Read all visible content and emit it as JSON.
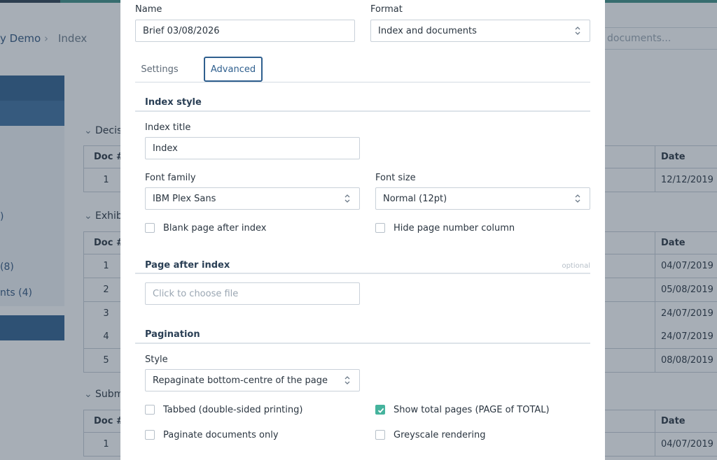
{
  "background": {
    "breadcrumb": {
      "project": "y Demo",
      "current": "Index"
    },
    "search_placeholder": "documents...",
    "sidebar": {
      "item1": ")",
      "item2": "(8)",
      "item3": "nts (4)"
    },
    "sections": [
      {
        "label": "Decis",
        "table": {
          "doc_header": "Doc #",
          "date_header": "Date",
          "rows": [
            {
              "doc": "1",
              "date": "12/12/2019"
            }
          ]
        }
      },
      {
        "label": "Exhib",
        "table": {
          "doc_header": "Doc #",
          "date_header": "Date",
          "rows": [
            {
              "doc": "1",
              "date": "04/07/2019"
            },
            {
              "doc": "2",
              "date": "05/08/2019"
            },
            {
              "doc": "3",
              "date": "24/07/2019"
            },
            {
              "doc": "4",
              "date": "24/07/2019"
            },
            {
              "doc": "5",
              "date": "08/08/2019"
            }
          ]
        }
      },
      {
        "label": "Subm",
        "table": {
          "doc_header": "Doc #",
          "date_header": "Date",
          "rows": [
            {
              "doc": "1",
              "date": "04/07/2019"
            }
          ]
        }
      }
    ]
  },
  "modal": {
    "name": {
      "label": "Name",
      "value": "Brief 03/08/2026"
    },
    "format": {
      "label": "Format",
      "value": "Index and documents"
    },
    "tabs": [
      {
        "label": "Settings",
        "active": false
      },
      {
        "label": "Advanced",
        "active": true
      }
    ],
    "index_style": {
      "title": "Index style",
      "index_title": {
        "label": "Index title",
        "value": "Index"
      },
      "font_family": {
        "label": "Font family",
        "value": "IBM Plex Sans"
      },
      "font_size": {
        "label": "Font size",
        "value": "Normal (12pt)"
      },
      "blank_page_after_index": {
        "label": "Blank page after index",
        "checked": false
      },
      "hide_page_number_column": {
        "label": "Hide page number column",
        "checked": false
      }
    },
    "page_after_index": {
      "title": "Page after index",
      "optional": "optional",
      "placeholder": "Click to choose file"
    },
    "pagination": {
      "title": "Pagination",
      "style": {
        "label": "Style",
        "value": "Repaginate bottom-centre of the page"
      },
      "tabbed": {
        "label": "Tabbed (double-sided printing)",
        "checked": false
      },
      "show_total_pages": {
        "label": "Show total pages (PAGE of TOTAL)",
        "checked": true
      },
      "paginate_documents_only": {
        "label": "Paginate documents only",
        "checked": false
      },
      "greyscale_rendering": {
        "label": "Greyscale rendering",
        "checked": false
      }
    }
  },
  "colors": {
    "accent": "#2f5f8e",
    "check": "#45b39d",
    "overlay": "#2d3e52"
  }
}
